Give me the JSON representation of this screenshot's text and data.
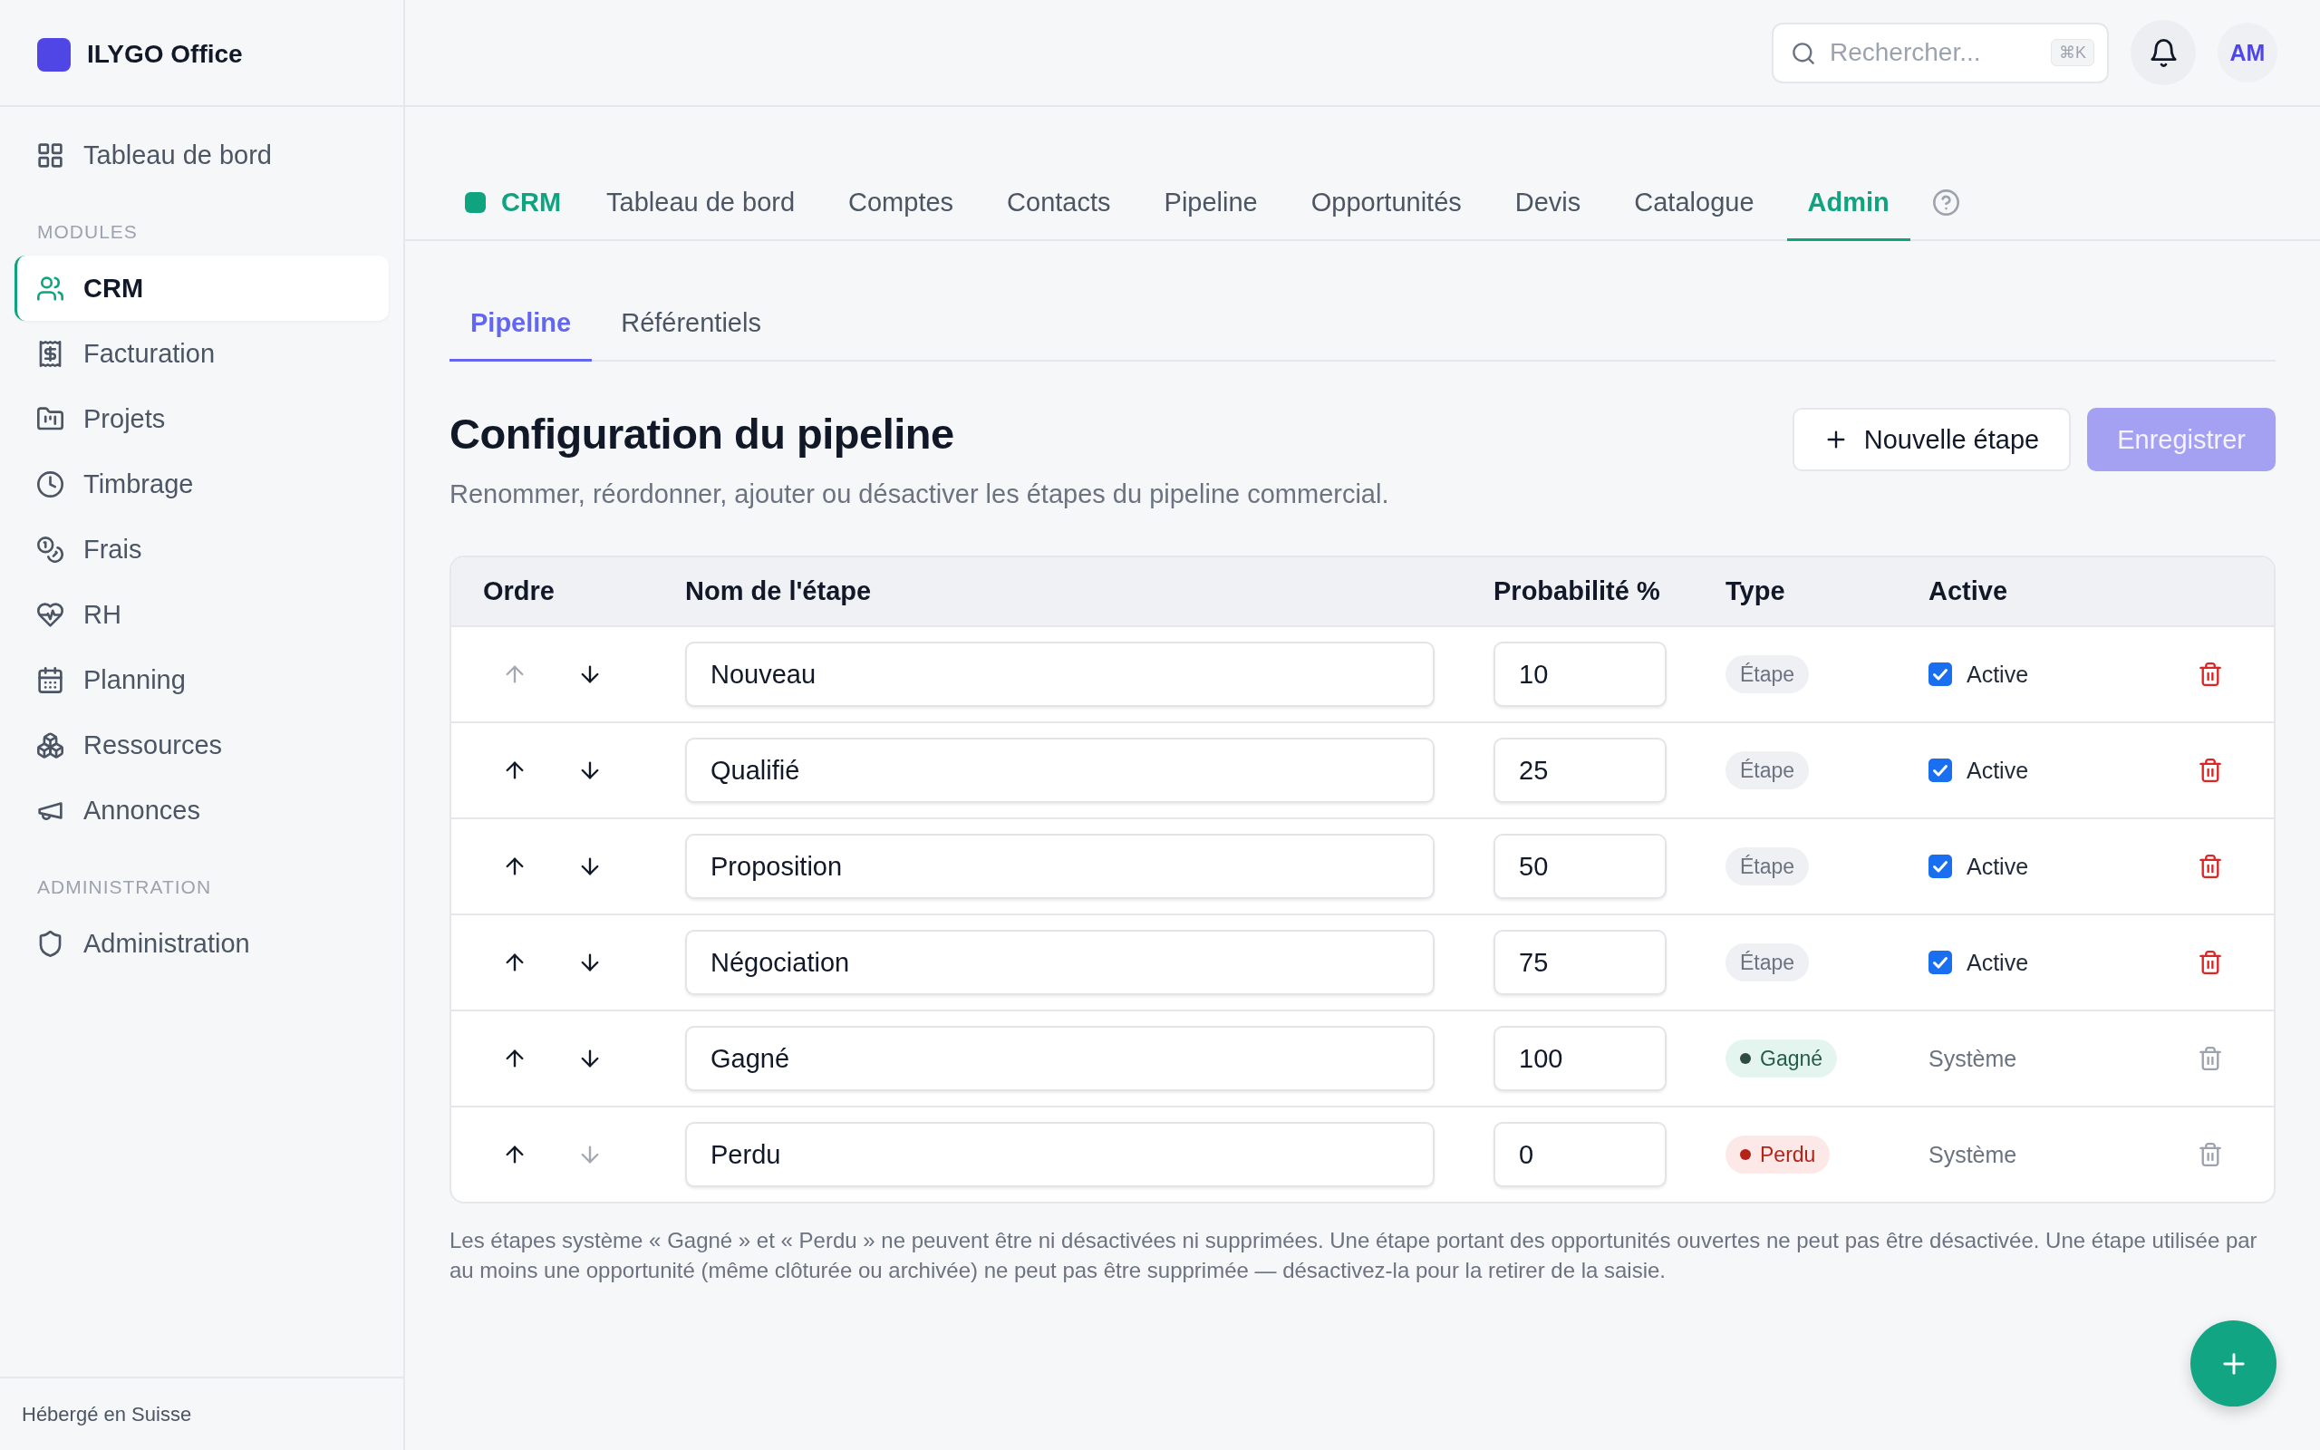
{
  "sidebar": {
    "brand": "ILYGO Office",
    "items": [
      {
        "label": "Tableau de bord",
        "selected": false
      }
    ],
    "sections": [
      {
        "title": "MODULES",
        "items": [
          {
            "label": "CRM",
            "selected": true
          },
          {
            "label": "Facturation",
            "selected": false
          },
          {
            "label": "Projets",
            "selected": false
          },
          {
            "label": "Timbrage",
            "selected": false
          },
          {
            "label": "Frais",
            "selected": false
          },
          {
            "label": "RH",
            "selected": false
          },
          {
            "label": "Planning",
            "selected": false
          },
          {
            "label": "Ressources",
            "selected": false
          },
          {
            "label": "Annonces",
            "selected": false
          }
        ]
      },
      {
        "title": "ADMINISTRATION",
        "items": [
          {
            "label": "Administration",
            "selected": false
          }
        ]
      }
    ],
    "footer": "Hébergé en Suisse"
  },
  "topbar": {
    "search": {
      "placeholder": "Rechercher...",
      "shortcut": "⌘K"
    },
    "avatar": "AM"
  },
  "module_nav": {
    "module": "CRM",
    "tabs": [
      {
        "label": "Tableau de bord",
        "selected": false
      },
      {
        "label": "Comptes",
        "selected": false
      },
      {
        "label": "Contacts",
        "selected": false
      },
      {
        "label": "Pipeline",
        "selected": false
      },
      {
        "label": "Opportunités",
        "selected": false
      },
      {
        "label": "Devis",
        "selected": false
      },
      {
        "label": "Catalogue",
        "selected": false
      },
      {
        "label": "Admin",
        "selected": true
      }
    ]
  },
  "sub_tabs": [
    {
      "label": "Pipeline",
      "selected": true
    },
    {
      "label": "Référentiels",
      "selected": false
    }
  ],
  "page": {
    "title": "Configuration du pipeline",
    "subtitle": "Renommer, réordonner, ajouter ou désactiver les étapes du pipeline commercial.",
    "buttons": [
      {
        "label": "Nouvelle étape",
        "kind": "add",
        "disabled": false
      },
      {
        "label": "Enregistrer",
        "kind": "primary",
        "disabled": true
      }
    ]
  },
  "table": {
    "columns": [
      "Ordre",
      "Nom de l'étape",
      "Probabilité %",
      "Type",
      "Active"
    ],
    "rows": [
      {
        "kind": "stage",
        "up_disabled": true,
        "down_disabled": false,
        "name": "Nouveau",
        "probability": "10",
        "type": {
          "kind": "stage",
          "label": "Étape"
        },
        "active": true,
        "active_label": "Active",
        "delete_disabled": false
      },
      {
        "kind": "stage",
        "up_disabled": false,
        "down_disabled": false,
        "name": "Qualifié",
        "probability": "25",
        "type": {
          "kind": "stage",
          "label": "Étape"
        },
        "active": true,
        "active_label": "Active",
        "delete_disabled": false
      },
      {
        "kind": "stage",
        "up_disabled": false,
        "down_disabled": false,
        "name": "Proposition",
        "probability": "50",
        "type": {
          "kind": "stage",
          "label": "Étape"
        },
        "active": true,
        "active_label": "Active",
        "delete_disabled": false
      },
      {
        "kind": "stage",
        "up_disabled": false,
        "down_disabled": false,
        "name": "Négociation",
        "probability": "75",
        "type": {
          "kind": "stage",
          "label": "Étape"
        },
        "active": true,
        "active_label": "Active",
        "delete_disabled": false
      },
      {
        "kind": "system",
        "up_disabled": false,
        "down_disabled": false,
        "name": "Gagné",
        "probability": "100",
        "type": {
          "kind": "won",
          "label": "Gagné"
        },
        "system_label": "Système",
        "delete_disabled": true
      },
      {
        "kind": "system",
        "up_disabled": false,
        "down_disabled": true,
        "name": "Perdu",
        "probability": "0",
        "type": {
          "kind": "lost",
          "label": "Perdu"
        },
        "system_label": "Système",
        "delete_disabled": true
      }
    ]
  },
  "footnote": "Les étapes système « Gagné » et « Perdu » ne peuvent être ni désactivées ni supprimées. Une étape portant des opportunités ouvertes ne peut pas être désactivée. Une étape utilisée par au moins une opportunité (même clôturée ou archivée) ne peut pas être supprimée — désactivez-la pour la retirer de la saisie."
}
